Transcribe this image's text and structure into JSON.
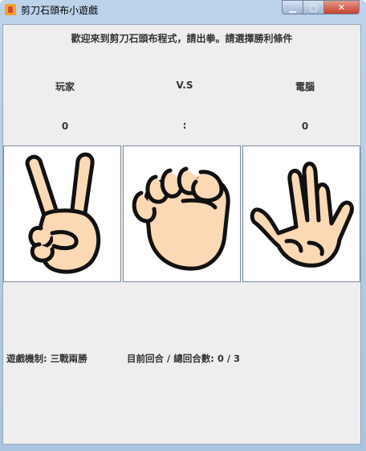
{
  "window": {
    "title": "剪刀石頭布小遊戲"
  },
  "welcome": "歡迎來到剪刀石頭布程式，請出拳。請選擇勝利條件",
  "labels": {
    "player": "玩家",
    "vs": "V.S",
    "computer": "電腦"
  },
  "scores": {
    "player": "0",
    "separator": ":",
    "computer": "0"
  },
  "choices": [
    {
      "icon": "scissors-hand-icon"
    },
    {
      "icon": "rock-fist-icon"
    },
    {
      "icon": "paper-hand-icon"
    }
  ],
  "footer": {
    "rule_label": "遊戲機制: 三戰兩勝",
    "round_label": "目前回合 / 總回合數: ",
    "round_value": "0 / 3"
  },
  "colors": {
    "skin": "#fcd9b5",
    "outline": "#111111",
    "panel": "#eeeeee"
  }
}
